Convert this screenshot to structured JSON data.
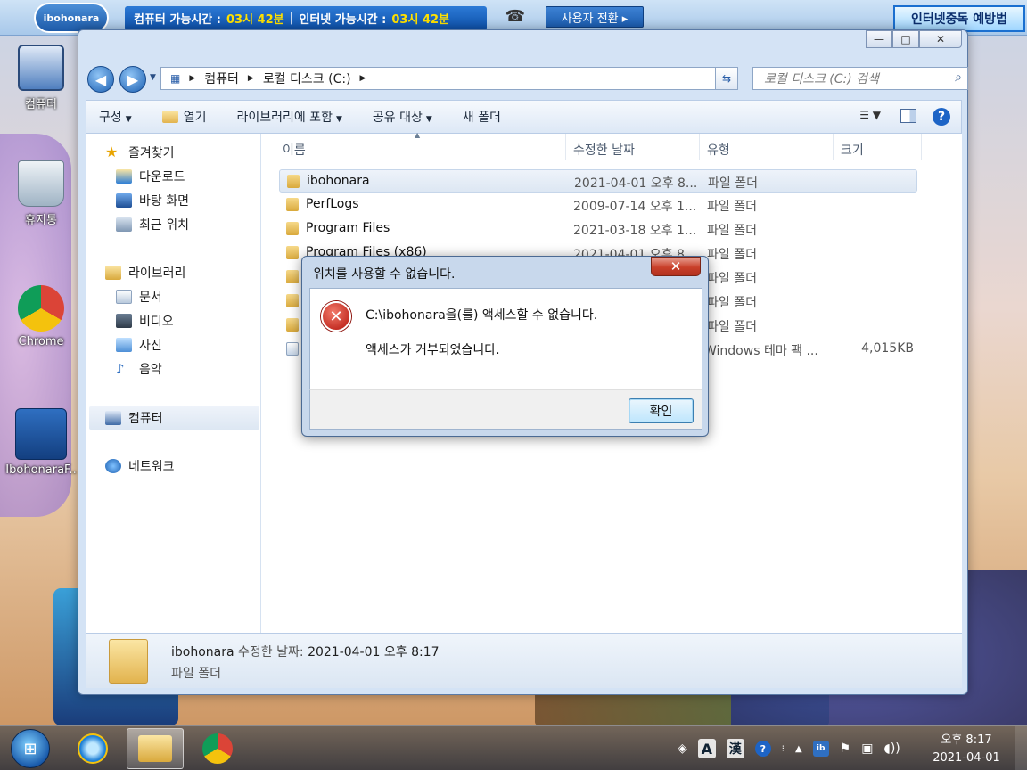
{
  "topbar": {
    "logo": "ibohonara",
    "computer_time_label": "컴퓨터 가능시간 :",
    "computer_time_value": "03시 42분",
    "internet_time_label": "인터넷 가능시간 :",
    "internet_time_value": "03시 42분",
    "switch_user": "사용자 전환 ▸",
    "banner": "인터넷중독 예방법"
  },
  "desktop": {
    "icons": [
      {
        "label": "컴퓨터",
        "icon": "computer-icon"
      },
      {
        "label": "휴지통",
        "icon": "recycle-bin-icon"
      },
      {
        "label": "Chrome",
        "icon": "chrome-icon"
      },
      {
        "label": "IbohonaraF..",
        "icon": "ibohonara-shield-icon"
      }
    ]
  },
  "explorer": {
    "address": [
      "컴퓨터",
      "로컬 디스크 (C:)"
    ],
    "search_placeholder": "로컬 디스크 (C:) 검색",
    "toolbar": {
      "organize": "구성",
      "open": "열기",
      "include_library": "라이브러리에 포함",
      "share": "공유 대상",
      "new_folder": "새 폴더"
    },
    "nav": {
      "favorites": "즐겨찾기",
      "downloads": "다운로드",
      "desktop": "바탕 화면",
      "recent": "최근 위치",
      "libraries": "라이브러리",
      "documents": "문서",
      "videos": "비디오",
      "pictures": "사진",
      "music": "음악",
      "computer": "컴퓨터",
      "network": "네트워크"
    },
    "columns": {
      "name": "이름",
      "modified": "수정한 날짜",
      "type": "유형",
      "size": "크기"
    },
    "rows": [
      {
        "name": "ibohonara",
        "modified": "2021-04-01 오후 8...",
        "type": "파일 폴더",
        "size": ""
      },
      {
        "name": "PerfLogs",
        "modified": "2009-07-14 오후 1...",
        "type": "파일 폴더",
        "size": ""
      },
      {
        "name": "Program Files",
        "modified": "2021-03-18 오후 1...",
        "type": "파일 폴더",
        "size": ""
      },
      {
        "name": "Program Files (x86)",
        "modified": "2021-04-01 오후 8...",
        "type": "파일 폴더",
        "size": ""
      },
      {
        "name": "",
        "modified": "",
        "type": "파일 폴더",
        "size": ""
      },
      {
        "name": "",
        "modified": "",
        "type": "파일 폴더",
        "size": ""
      },
      {
        "name": "",
        "modified": "",
        "type": "파일 폴더",
        "size": ""
      },
      {
        "name": "",
        "modified": "",
        "type": "Windows 테마 팩 ...",
        "size": "4,015KB"
      }
    ],
    "details": {
      "name": "ibohonara",
      "modified_label": "수정한 날짜:",
      "modified_value": "2021-04-01 오후 8:17",
      "type": "파일 폴더"
    }
  },
  "dialog": {
    "title": "위치를 사용할 수 없습니다.",
    "message": "C:\\ibohonara을(를) 액세스할 수 없습니다.",
    "detail": "액세스가 거부되었습니다.",
    "ok": "확인"
  },
  "taskbar": {
    "time": "오후 8:17",
    "date": "2021-04-01",
    "ime_a": "A",
    "ime_han": "漢"
  }
}
